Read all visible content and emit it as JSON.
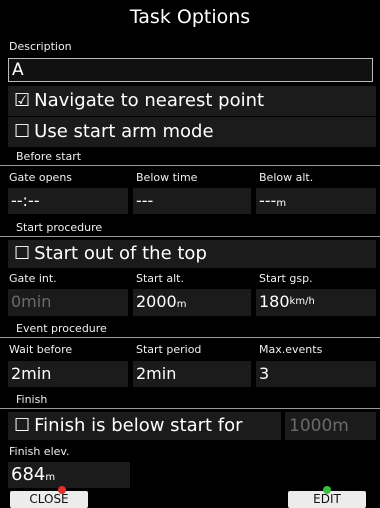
{
  "title": "Task Options",
  "description": {
    "label": "Description",
    "value": "A"
  },
  "navigate_nearest": {
    "checked": true,
    "label": "Navigate to nearest point"
  },
  "start_arm": {
    "checked": false,
    "label": "Use start arm mode"
  },
  "before_start": {
    "section": "Before start",
    "gate_opens": {
      "label": "Gate opens",
      "value": "--:--"
    },
    "below_time": {
      "label": "Below time",
      "value": "---"
    },
    "below_alt": {
      "label": "Below alt.",
      "value": "---",
      "unit": "m"
    }
  },
  "start_procedure": {
    "section": "Start procedure",
    "out_of_top": {
      "checked": false,
      "label": "Start out of the top"
    },
    "gate_int": {
      "label": "Gate int.",
      "value": "0min"
    },
    "start_alt": {
      "label": "Start alt.",
      "value": "2000",
      "unit": "m"
    },
    "start_gsp": {
      "label": "Start gsp.",
      "value": "180",
      "unit": "km/h"
    }
  },
  "event_procedure": {
    "section": "Event procedure",
    "wait_before": {
      "label": "Wait before",
      "value": "2min"
    },
    "start_period": {
      "label": "Start period",
      "value": "2min"
    },
    "max_events": {
      "label": "Max.events",
      "value": "3"
    }
  },
  "finish": {
    "section": "Finish",
    "below_start": {
      "checked": false,
      "label": "Finish is below start for",
      "value": "1000m"
    },
    "elev": {
      "label": "Finish elev.",
      "value": "684",
      "unit": "m"
    }
  },
  "buttons": {
    "close": "CLOSE",
    "edit": "EDIT"
  },
  "colors": {
    "close_indicator": "#e0302a",
    "edit_indicator": "#3cbf3c"
  }
}
